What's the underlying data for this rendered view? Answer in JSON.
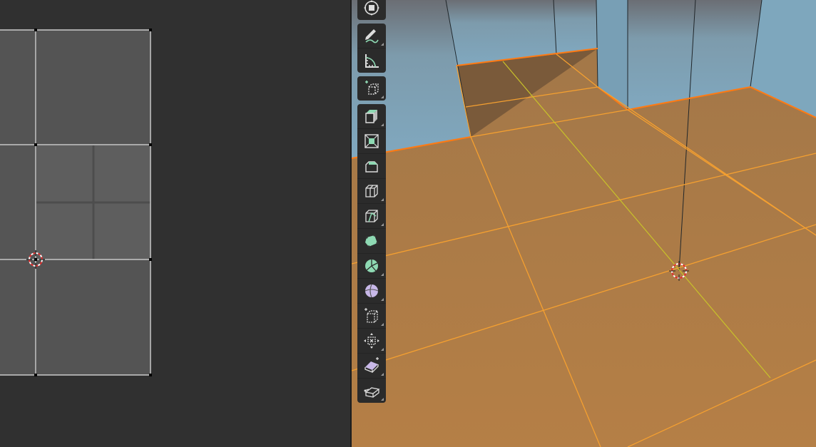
{
  "colors": {
    "background": "#303030",
    "uv_face": "#545454",
    "uv_face_selected": "#5f5f5f",
    "uv_edge": "#ffffff",
    "floor": "#b07a42",
    "wall": "#7fa3b8",
    "selection_edge": "#ff8a1c",
    "tool_accent": "#8ed9b3",
    "tool_accent_alt": "#c8b8e8"
  },
  "toolbar": {
    "tools": [
      {
        "id": "transform",
        "icon": "transform-gizmo-icon",
        "group": 0
      },
      {
        "id": "annotate",
        "icon": "annotate-pencil-icon",
        "group": 1,
        "corner": true
      },
      {
        "id": "measure",
        "icon": "measure-ruler-icon",
        "group": 1
      },
      {
        "id": "add-cube",
        "icon": "add-cube-icon",
        "group": 2,
        "corner": true
      },
      {
        "id": "extrude",
        "icon": "extrude-region-icon",
        "group": 3,
        "corner": true
      },
      {
        "id": "inset",
        "icon": "inset-faces-icon",
        "group": 3
      },
      {
        "id": "bevel",
        "icon": "bevel-icon",
        "group": 3
      },
      {
        "id": "loop-cut",
        "icon": "loop-cut-icon",
        "group": 3,
        "corner": true
      },
      {
        "id": "knife",
        "icon": "knife-icon",
        "group": 3,
        "corner": true
      },
      {
        "id": "poly-build",
        "icon": "poly-build-icon",
        "group": 3
      },
      {
        "id": "spin",
        "icon": "spin-icon",
        "group": 3,
        "corner": true
      },
      {
        "id": "smooth",
        "icon": "smooth-vertices-icon",
        "group": 3,
        "corner": true
      },
      {
        "id": "edge-slide",
        "icon": "edge-slide-icon",
        "group": 3,
        "corner": true
      },
      {
        "id": "shrink-fatten",
        "icon": "shrink-fatten-icon",
        "group": 3,
        "corner": true
      },
      {
        "id": "shear",
        "icon": "shear-icon",
        "group": 3,
        "corner": true
      },
      {
        "id": "rip",
        "icon": "rip-region-icon",
        "group": 3,
        "corner": true
      }
    ]
  }
}
